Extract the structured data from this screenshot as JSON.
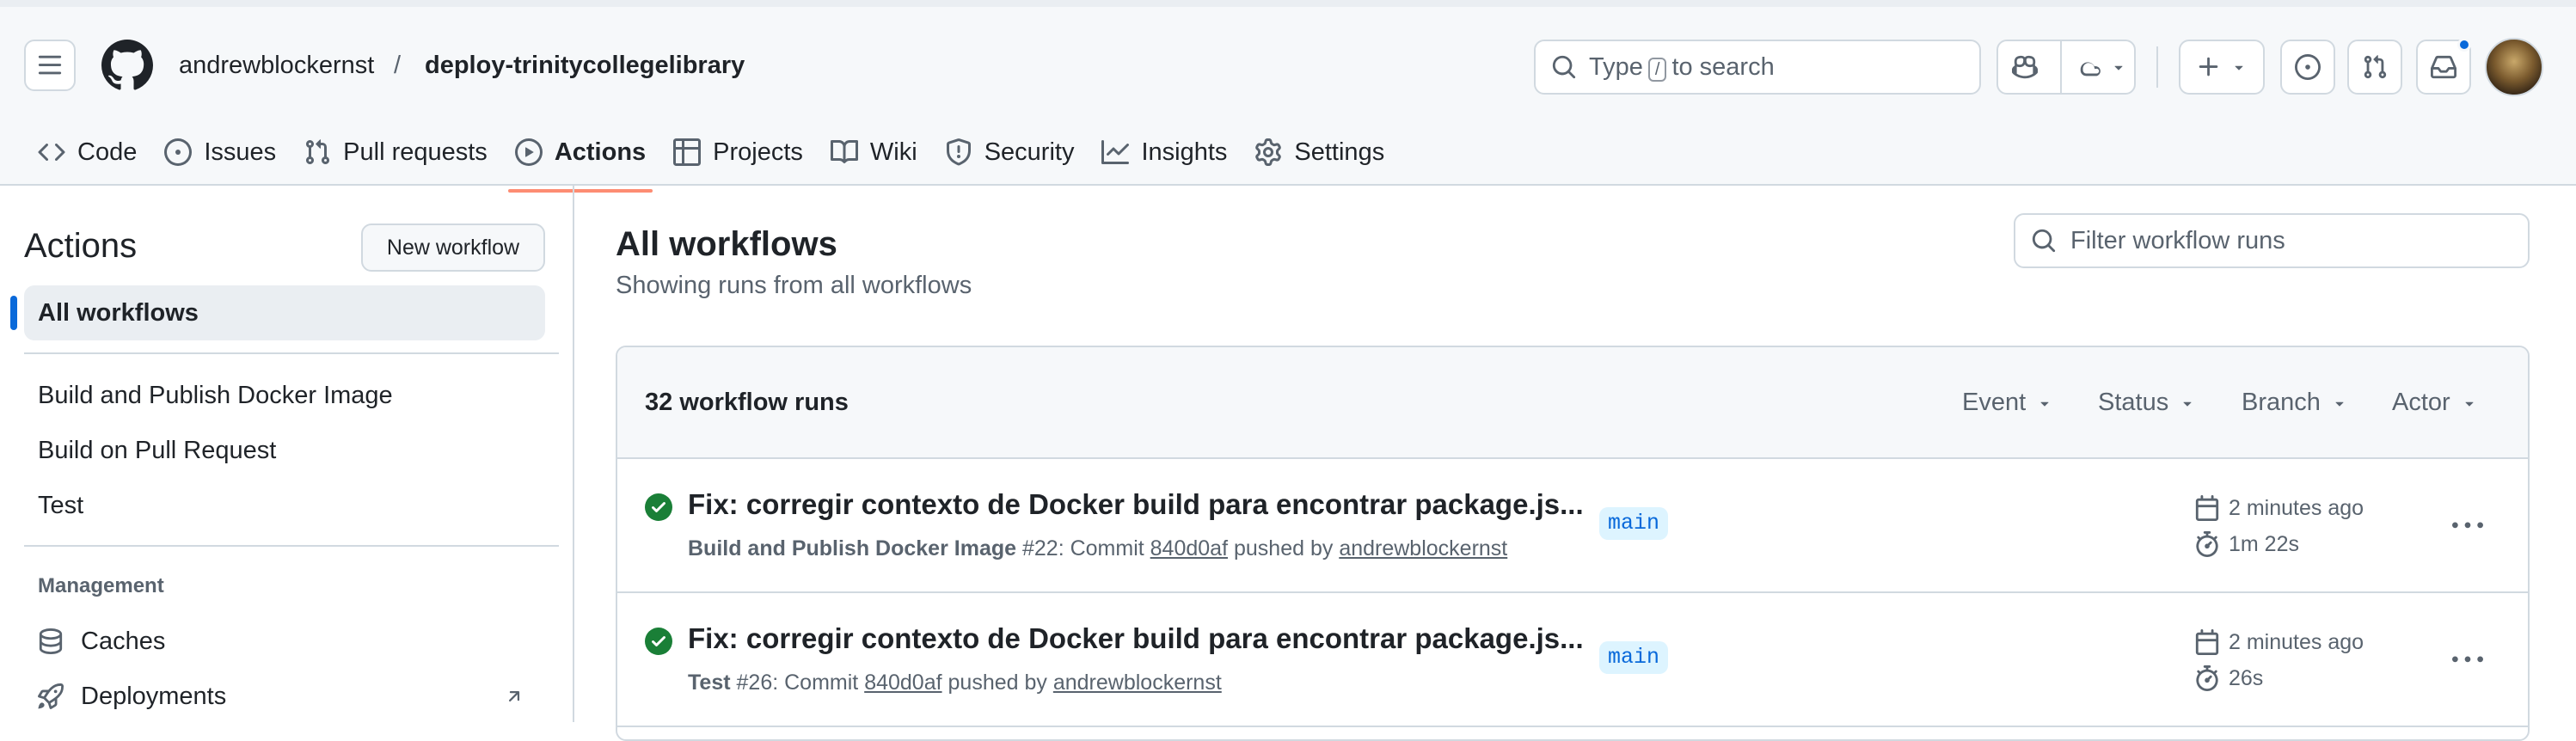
{
  "header": {
    "owner": "andrewblockernst",
    "separator": "/",
    "repo": "deploy-trinitycollegelibrary",
    "search": {
      "prefix": "Type",
      "key": "/",
      "suffix": "to search"
    },
    "icons": [
      "menu-icon",
      "github-logo",
      "search-icon",
      "copilot-icon",
      "cloud-icon",
      "plus-icon",
      "issue-opened-icon",
      "pull-request-icon",
      "inbox-icon",
      "avatar"
    ]
  },
  "repo_nav": [
    {
      "label": "Code",
      "icon": "code-icon"
    },
    {
      "label": "Issues",
      "icon": "issue-icon"
    },
    {
      "label": "Pull requests",
      "icon": "pull-request-icon"
    },
    {
      "label": "Actions",
      "icon": "play-icon",
      "selected": true
    },
    {
      "label": "Projects",
      "icon": "table-icon"
    },
    {
      "label": "Wiki",
      "icon": "book-icon"
    },
    {
      "label": "Security",
      "icon": "shield-icon"
    },
    {
      "label": "Insights",
      "icon": "graph-icon"
    },
    {
      "label": "Settings",
      "icon": "gear-icon"
    }
  ],
  "sidebar": {
    "title": "Actions",
    "new_workflow": "New workflow",
    "all_workflows": "All workflows",
    "workflows": [
      "Build and Publish Docker Image",
      "Build on Pull Request",
      "Test"
    ],
    "management_label": "Management",
    "management": [
      {
        "label": "Caches",
        "icon": "database-icon"
      },
      {
        "label": "Deployments",
        "icon": "rocket-icon"
      }
    ]
  },
  "main": {
    "title": "All workflows",
    "subtitle": "Showing runs from all workflows",
    "filter_placeholder": "Filter workflow runs",
    "runs_count": "32 workflow runs",
    "filters": [
      "Event",
      "Status",
      "Branch",
      "Actor"
    ],
    "runs": [
      {
        "title": "Fix: corregir contexto de Docker build para encontrar package.js...",
        "workflow": "Build and Publish Docker Image",
        "number": "#22",
        "commit_label": ": Commit",
        "commit": "840d0af",
        "pushed_by": "pushed by",
        "actor": "andrewblockernst",
        "branch": "main",
        "time": "2 minutes ago",
        "duration": "1m 22s",
        "status": "success"
      },
      {
        "title": "Fix: corregir contexto de Docker build para encontrar package.js...",
        "workflow": "Test",
        "number": "#26",
        "commit_label": ": Commit",
        "commit": "840d0af",
        "pushed_by": "pushed by",
        "actor": "andrewblockernst",
        "branch": "main",
        "time": "2 minutes ago",
        "duration": "26s",
        "status": "success"
      }
    ]
  },
  "colors": {
    "accent": "#0969da",
    "success": "#1a7f37",
    "selected_underline": "#fd8c73",
    "border": "#d1d9e0",
    "muted": "#59636e"
  }
}
